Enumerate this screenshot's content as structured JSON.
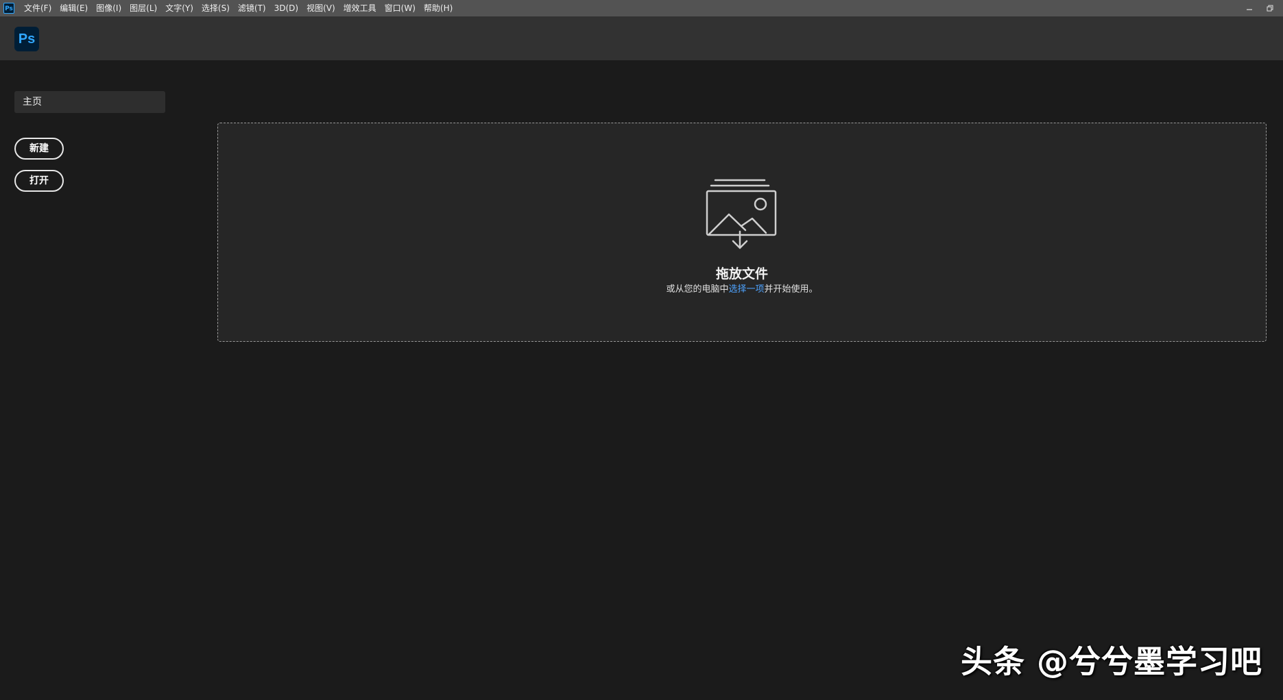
{
  "menubar": {
    "app_icon": "Ps",
    "items": [
      "文件(F)",
      "编辑(E)",
      "图像(I)",
      "图层(L)",
      "文字(Y)",
      "选择(S)",
      "滤镜(T)",
      "3D(D)",
      "视图(V)",
      "增效工具",
      "窗口(W)",
      "帮助(H)"
    ]
  },
  "header": {
    "logo_text": "Ps"
  },
  "sidebar": {
    "home_label": "主页",
    "new_label": "新建",
    "open_label": "打开"
  },
  "dropzone": {
    "title": "拖放文件",
    "sub_prefix": "或从您的电脑中",
    "sub_link": "选择一项",
    "sub_suffix": "并开始使用。",
    "icon": "image-stack-download-icon"
  },
  "watermark": {
    "text": "头条 @兮兮墨学习吧"
  },
  "colors": {
    "menubar_bg": "#535353",
    "header_bg": "#323232",
    "app_bg": "#1b1b1b",
    "dropzone_bg": "#262626",
    "ps_blue": "#31a8ff",
    "ps_dark": "#001e36",
    "link": "#4ea3ff"
  }
}
